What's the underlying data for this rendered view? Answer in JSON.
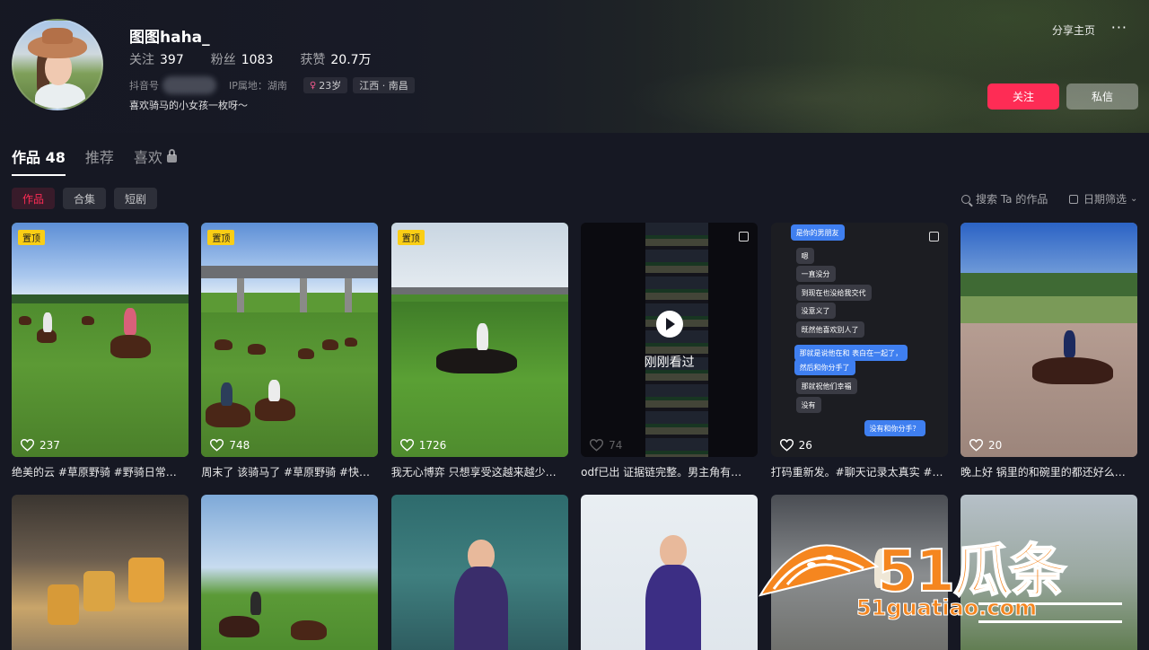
{
  "profile": {
    "name": "图图haha_",
    "stats": [
      {
        "label": "关注",
        "value": "397"
      },
      {
        "label": "粉丝",
        "value": "1083"
      },
      {
        "label": "获赞",
        "value": "20.7万"
      }
    ],
    "douyin_id_label": "抖音号",
    "ip_label": "IP属地：湖南",
    "tags": [
      "23岁",
      "江西 · 南昌"
    ],
    "gender_icon": "female-icon",
    "bio": "喜欢骑马的小女孩一枚呀～",
    "share_label": "分享主页",
    "more_label": "···",
    "follow_label": "关注",
    "message_label": "私信"
  },
  "tabs": [
    {
      "label": "作品 48",
      "active": true
    },
    {
      "label": "推荐",
      "active": false
    },
    {
      "label": "喜欢",
      "active": false,
      "locked": true
    }
  ],
  "subtabs": [
    {
      "label": "作品",
      "active": true
    },
    {
      "label": "合集",
      "active": false
    },
    {
      "label": "短剧",
      "active": false
    }
  ],
  "toolbar": {
    "search_label": "搜索 Ta 的作品",
    "date_filter_label": "日期筛选"
  },
  "pin_label": "置顶",
  "watched_label": "刚刚看过",
  "videos": [
    {
      "likes": "237",
      "caption": "绝美的云 #草原野骑 #野骑日常…",
      "pinned": true
    },
    {
      "likes": "748",
      "caption": "周末了 该骑马了 #草原野骑 #快…",
      "pinned": true
    },
    {
      "likes": "1726",
      "caption": "我无心博弈 只想享受这越来越少…",
      "pinned": true
    },
    {
      "likes": "74",
      "caption": "odf已出 证据链完整。男主角有…",
      "pinned": false,
      "watched": true
    },
    {
      "likes": "26",
      "caption": "打码重新发。#聊天记录太真实 #…",
      "pinned": false
    },
    {
      "likes": "20",
      "caption": "晚上好 锅里的和碗里的都还好么…",
      "pinned": false
    }
  ],
  "chat_lines": [
    {
      "side": "l",
      "text": "嗯"
    },
    {
      "side": "l",
      "text": "一直没分"
    },
    {
      "side": "l",
      "text": "到现在也没给我交代"
    },
    {
      "side": "l",
      "text": "没意义了"
    },
    {
      "side": "l",
      "text": "既然他喜欢别人了"
    },
    {
      "side": "r",
      "text": "那就是说他在和     表白在一起了，"
    },
    {
      "side": "r",
      "text": "然后和你分手了"
    },
    {
      "side": "l",
      "text": "那就祝他们幸福"
    },
    {
      "side": "l",
      "text": "没有"
    },
    {
      "side": "r",
      "text": "没有和你分手？"
    }
  ],
  "chat_top": "是你的男朋友",
  "watermark": {
    "main": "51瓜条",
    "sub": "51guatiao.com"
  },
  "colors": {
    "background": "#161823",
    "accent": "#fe2c55",
    "pin": "#face15",
    "watermark": "#f5861f"
  }
}
